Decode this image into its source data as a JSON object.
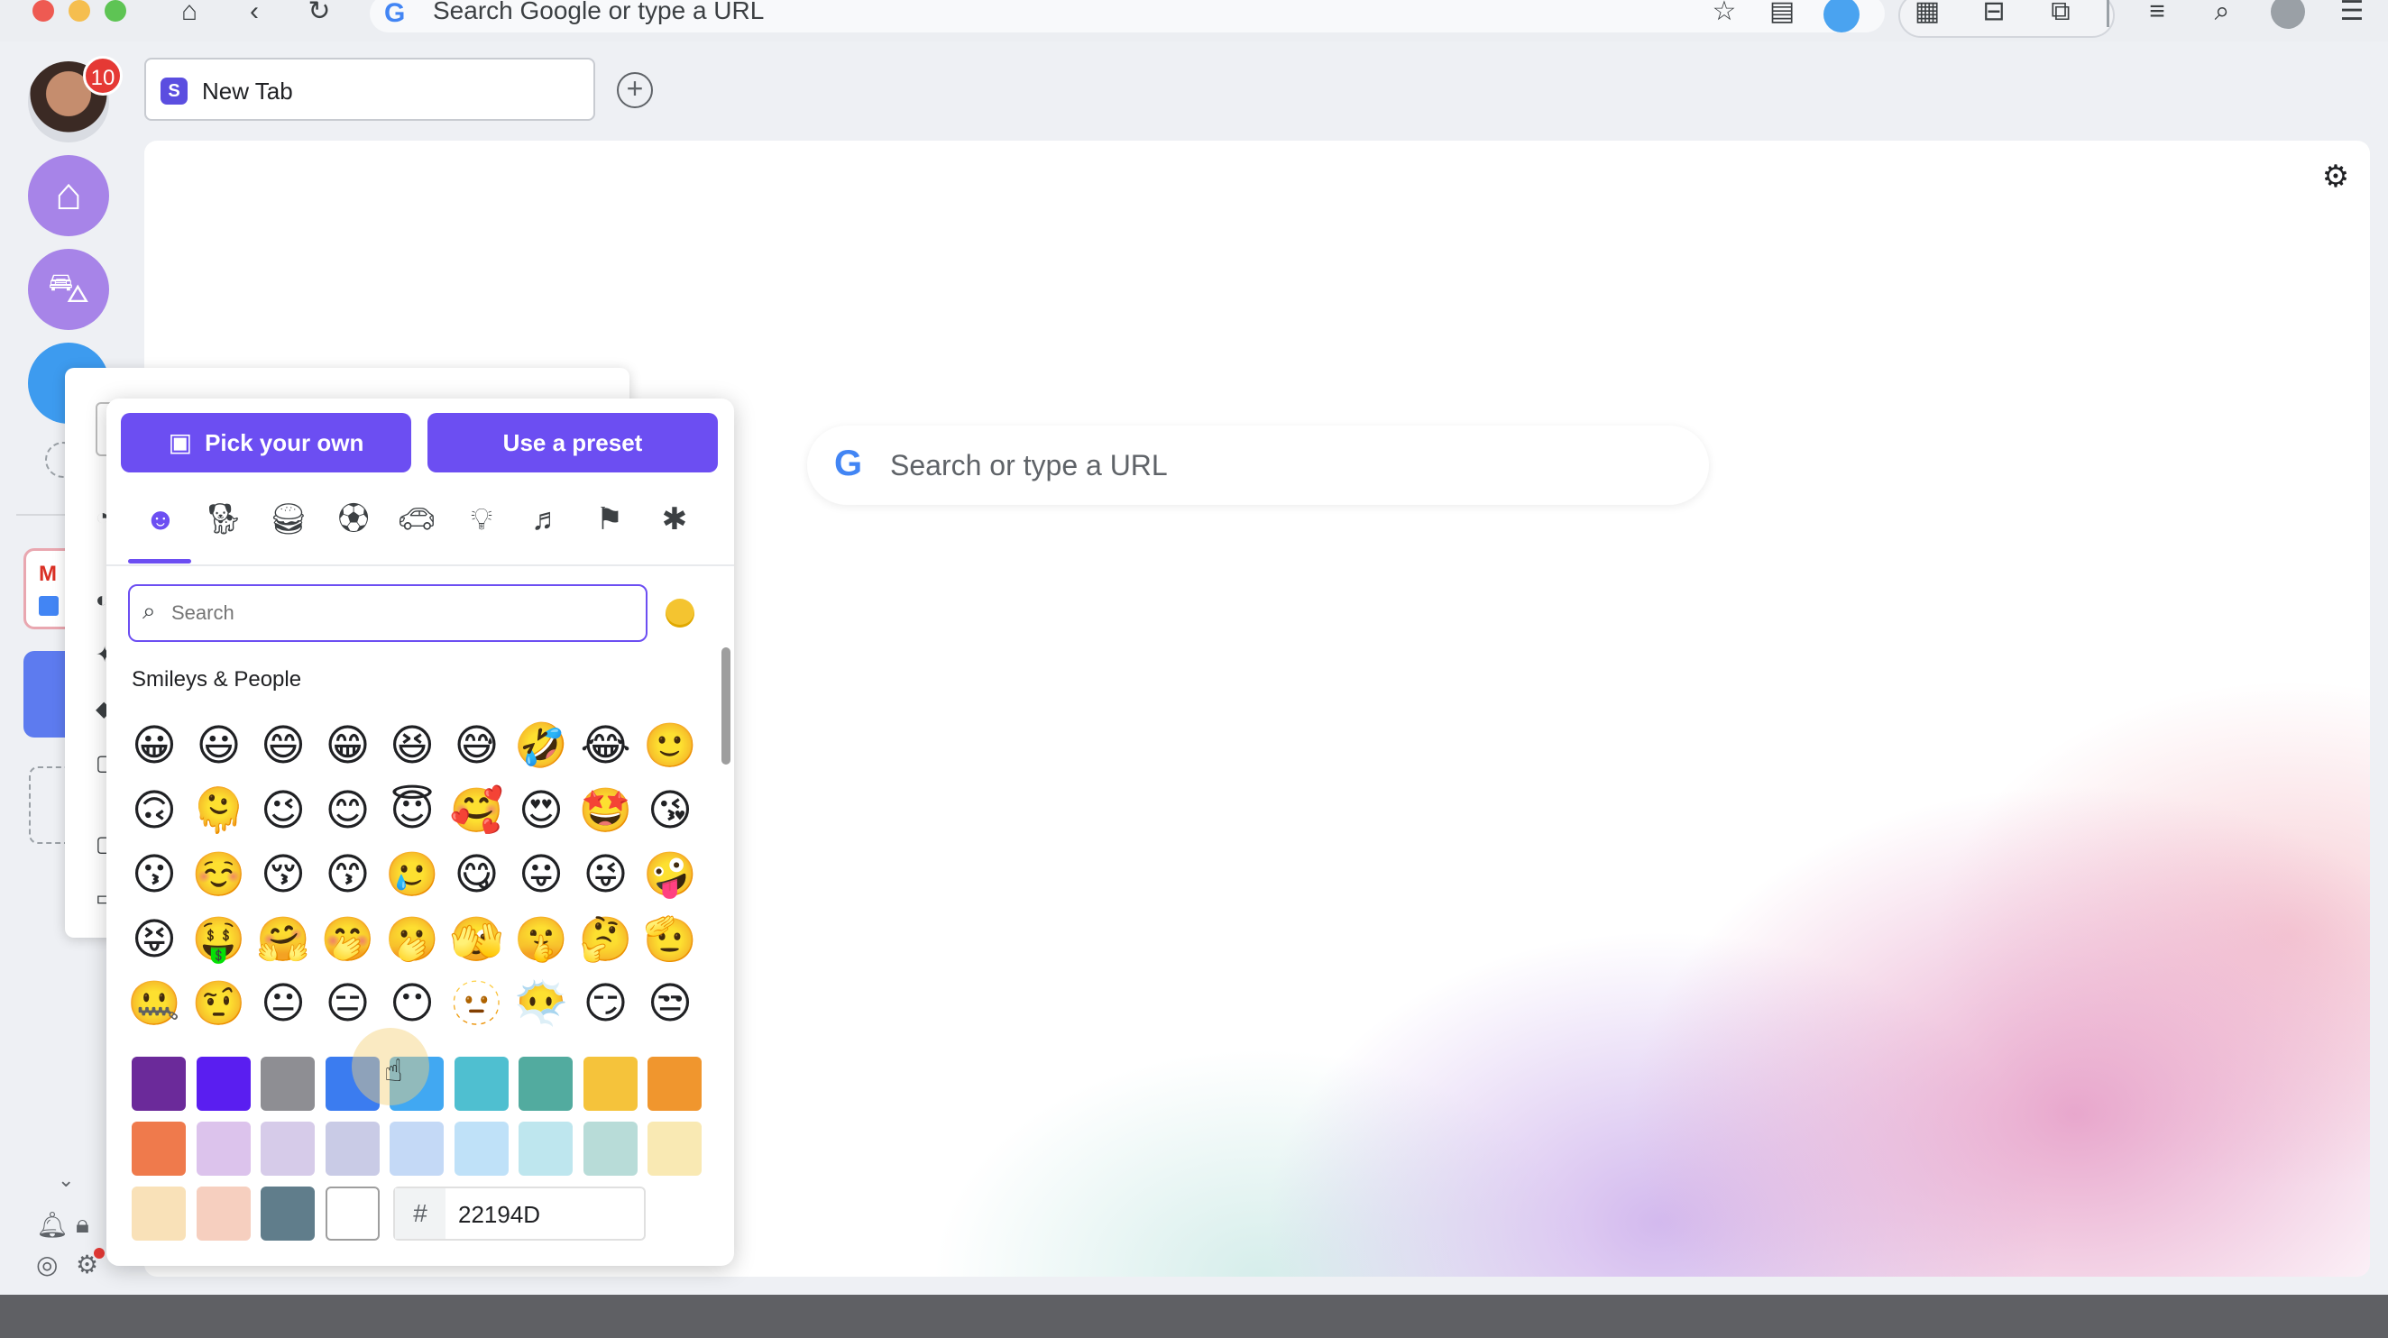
{
  "browser": {
    "address_placeholder": "Search Google or type a URL",
    "tab_title": "New Tab",
    "notification_count": "10"
  },
  "content": {
    "search_placeholder": "Search or type a URL"
  },
  "picker": {
    "pick_own_label": "Pick your own",
    "preset_label": "Use a preset",
    "search_placeholder": "Search",
    "section_title": "Smileys & People",
    "hex_prefix": "#",
    "hex_value": "22194D",
    "categories": [
      "smileys",
      "animals",
      "food",
      "activities",
      "travel",
      "objects",
      "symbols",
      "flags",
      "custom"
    ],
    "emoji_rows": [
      [
        "😀",
        "😃",
        "😄",
        "😁",
        "😆",
        "😅",
        "🤣",
        "😂",
        "🙂"
      ],
      [
        "🙃",
        "🫠",
        "😉",
        "😊",
        "😇",
        "🥰",
        "😍",
        "🤩",
        "😘"
      ],
      [
        "😗",
        "☺️",
        "😚",
        "😙",
        "🥲",
        "😋",
        "😛",
        "😜",
        "🤪"
      ],
      [
        "😝",
        "🤑",
        "🤗",
        "🤭",
        "🫢",
        "🫣",
        "🤫",
        "🤔",
        "🫡"
      ],
      [
        "🤐",
        "🤨",
        "😐",
        "😑",
        "😶",
        "🫥",
        "😶‍🌫️",
        "😏",
        "😒"
      ]
    ],
    "swatch_rows": [
      [
        "#6b2a9a",
        "#5a1ef0",
        "#8e8e93",
        "#3b7cf0",
        "#41a8f2",
        "#4fbfd0",
        "#52ab9f",
        "#f5c33b",
        "#f0962e"
      ],
      [
        "#ef7a4c",
        "#dcc3ec",
        "#d6cbe9",
        "#c9cbe6",
        "#c4d9f6",
        "#bfe1f8",
        "#bee6ee",
        "#b8dcd8",
        "#f9e9b3"
      ],
      [
        "#f9e1b8",
        "#f6cfbf",
        "#607d8b",
        "#ffffff"
      ]
    ]
  }
}
